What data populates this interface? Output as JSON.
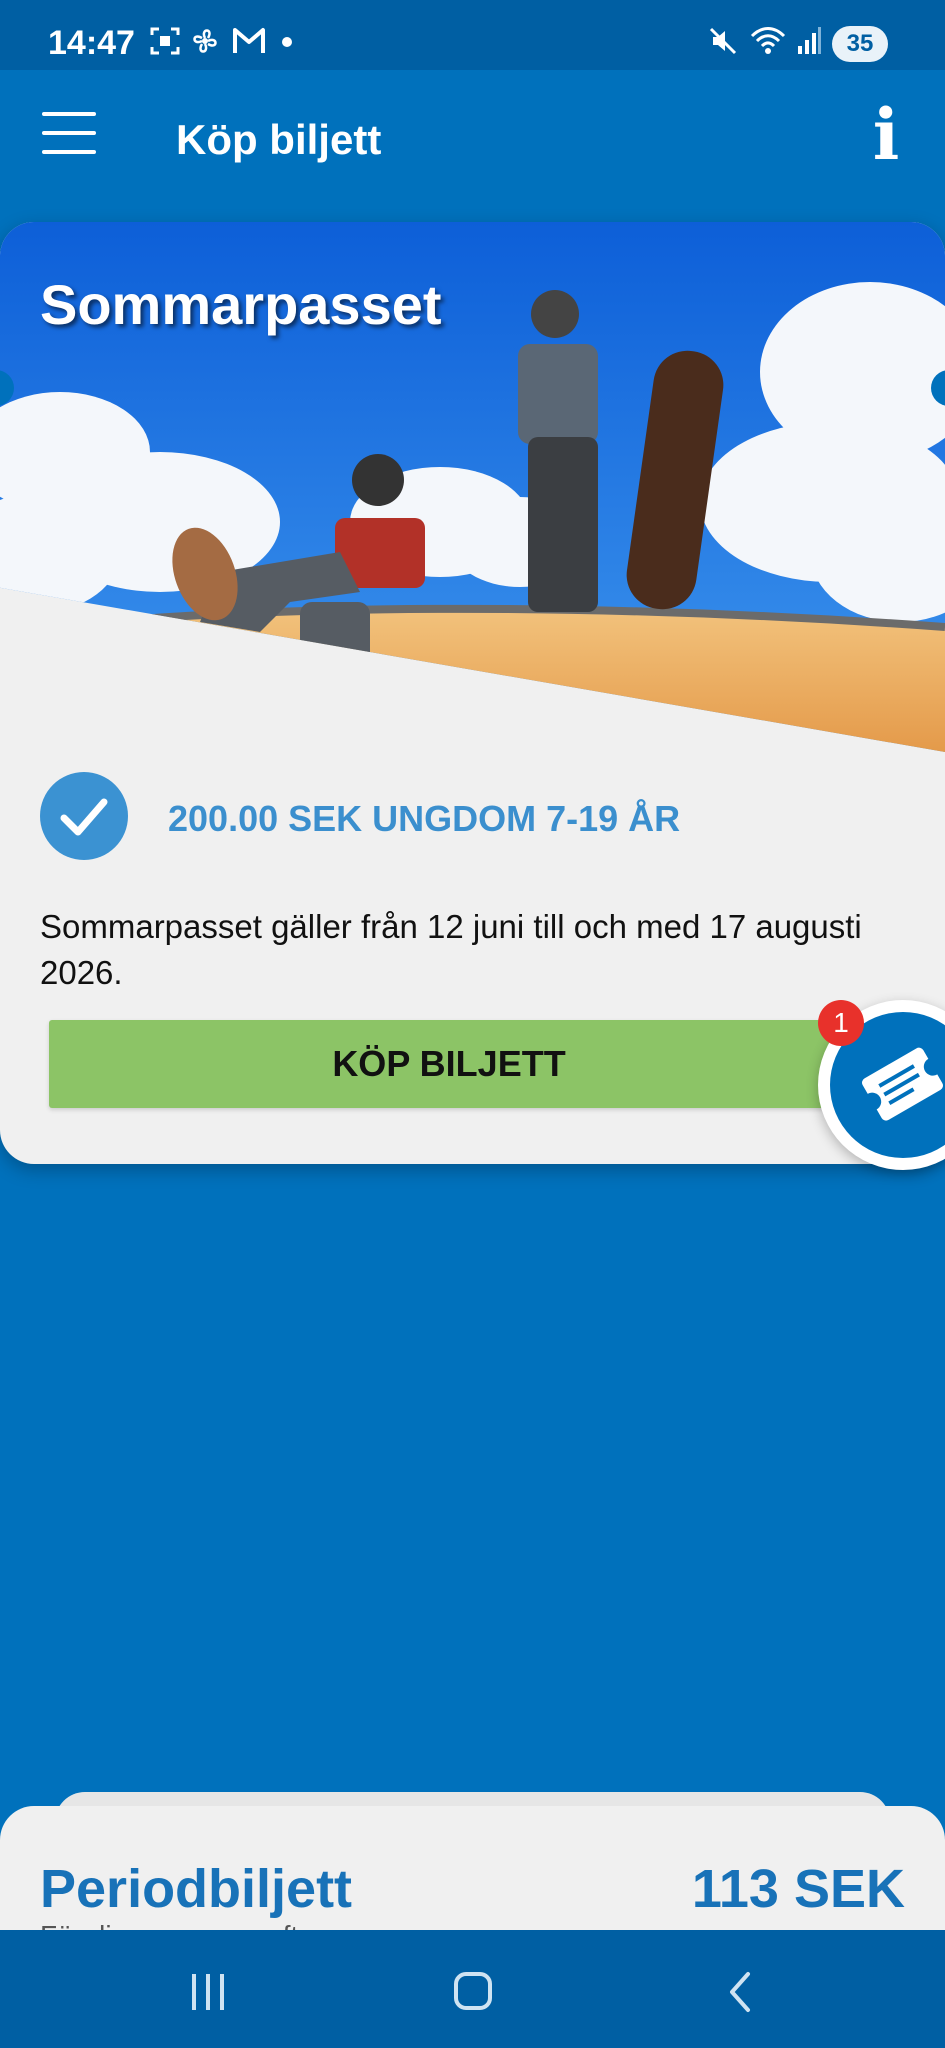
{
  "status_bar": {
    "time": "14:47",
    "battery": "35",
    "icons": [
      "screenshot-icon",
      "pinwheel-icon",
      "gmail-icon",
      "notification-dot-icon",
      "mute-icon",
      "wifi-icon",
      "signal-icon"
    ]
  },
  "app_bar": {
    "title": "Köp biljett",
    "menu_icon": "hamburger-menu-icon",
    "info_icon": "info-icon",
    "info_glyph": "i"
  },
  "ticket_card": {
    "title": "Sommarpasset",
    "option_label": "200.00 SEK UNGDOM 7-19 ÅR",
    "option_selected": true,
    "description": "Sommarpasset gäller från 12 juni till och med 17 augusti 2026.",
    "buy_button": "KÖP BILJETT"
  },
  "cart_fab": {
    "icon": "ticket-cart-icon",
    "badge_count": "1"
  },
  "next_card": {
    "title": "Periodbiljett",
    "price": "113 SEK",
    "subtitle": "För dig som reser ofta"
  },
  "nav_bar": {
    "icons": [
      "recent-apps-icon",
      "home-icon",
      "back-icon"
    ]
  },
  "colors": {
    "primary": "#0071bc",
    "status_bar": "#005fa3",
    "accent_text": "#3b8fce",
    "buy_button": "#8cc466",
    "badge": "#e8312b",
    "card": "#f0f0f0"
  }
}
